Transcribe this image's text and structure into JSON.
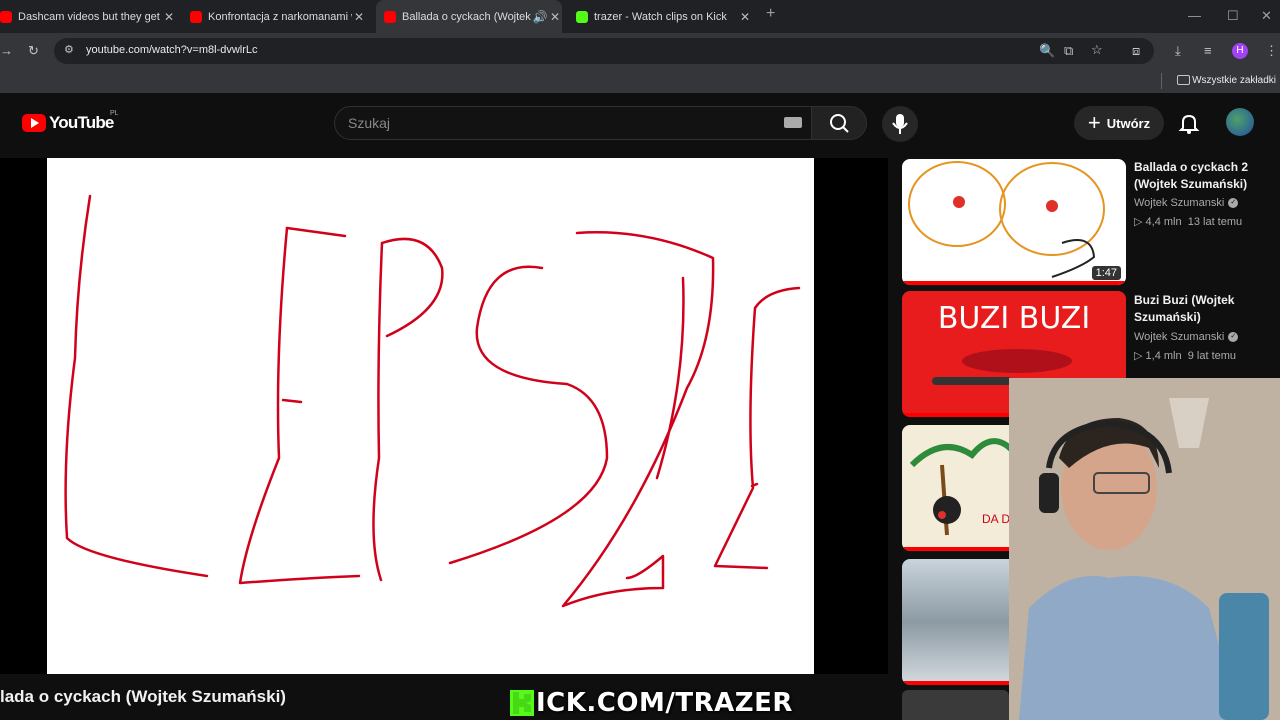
{
  "browser": {
    "tabs": [
      {
        "title": "Dashcam videos but they get in",
        "favicon": "youtube",
        "active": false
      },
      {
        "title": "Konfrontacja z narkomanami w",
        "favicon": "youtube",
        "active": false
      },
      {
        "title": "Ballada o cyckach (Wojtek S",
        "favicon": "youtube",
        "active": true
      },
      {
        "title": "trazer - Watch clips on Kick",
        "favicon": "kick",
        "active": false
      }
    ],
    "url": "youtube.com/watch?v=m8l-dvwlrLc",
    "bookmarks_all": "Wszystkie zakładki",
    "profile_initial": "H"
  },
  "youtube": {
    "logo_text": "YouTube",
    "country": "PL",
    "search_placeholder": "Szukaj",
    "create_label": "Utwórz"
  },
  "video": {
    "title": "lada o cyckach (Wojtek Szumański)",
    "drawing_text": "LEPSZE"
  },
  "recommendations": [
    {
      "title": "Ballada o cyckach 2 (Wojtek Szumański)",
      "channel": "Wojtek Szumanski",
      "views": "4,4 mln",
      "age": "13 lat temu",
      "duration": "1:47",
      "progress_pct": 100
    },
    {
      "title": "Buzi Buzi (Wojtek Szumański)",
      "channel": "Wojtek Szumanski",
      "views": "1,4 mln",
      "age": "9 lat temu",
      "thumb_text": "BUZI BUZI",
      "progress_pct": 100
    },
    {
      "thumb_text": "DA DAM",
      "progress_pct": 100
    },
    {
      "progress_pct": 100
    }
  ],
  "overlay": {
    "kick_text": "ICK.COM/TRAZER",
    "kick_letter": "K"
  },
  "colors": {
    "youtube_red": "#ff0000",
    "kick_green": "#53fc18",
    "drawing_red": "#d0021b"
  }
}
